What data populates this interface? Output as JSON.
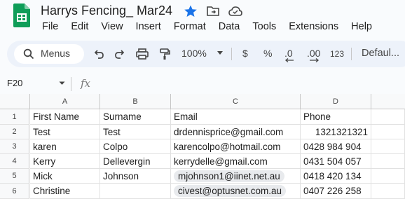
{
  "doc": {
    "title": "Harrys Fencing_ Mar24"
  },
  "menu": [
    "File",
    "Edit",
    "View",
    "Insert",
    "Format",
    "Data",
    "Tools",
    "Extensions",
    "Help"
  ],
  "toolbar": {
    "search_label": "Menus",
    "zoom": "100%",
    "currency": "$",
    "percent": "%",
    "dec_decrease": ".0",
    "dec_increase": ".00",
    "number_format": "123",
    "font": "Defaul..."
  },
  "formula_bar": {
    "cell_ref": "F20",
    "fx": "fx"
  },
  "sheet": {
    "columns": [
      "A",
      "B",
      "C",
      "D"
    ],
    "row_numbers": [
      "1",
      "2",
      "3",
      "4",
      "5",
      "6"
    ],
    "rows": [
      [
        "First Name",
        "Surname",
        "Email",
        "Phone"
      ],
      [
        "Test",
        "Test",
        "drdennisprice@gmail.com",
        "1321321321"
      ],
      [
        "karen",
        "Colpo",
        "karencolpo@hotmail.com",
        "0428 984 904"
      ],
      [
        "Kerry",
        "Dellevergin",
        "kerrydelle@gmail.com",
        "0431 504 057"
      ],
      [
        "Mick",
        "Johnson",
        "mjohnson1@iinet.net.au",
        "0418 420 134"
      ],
      [
        "Christine",
        "",
        "civest@optusnet.com.au",
        "0407 226 258"
      ]
    ]
  },
  "colors": {
    "accent": "#0b57d0",
    "star": "#1a73e8",
    "logo_green": "#0f9d58",
    "toolbar_bg": "#edf2fa"
  }
}
